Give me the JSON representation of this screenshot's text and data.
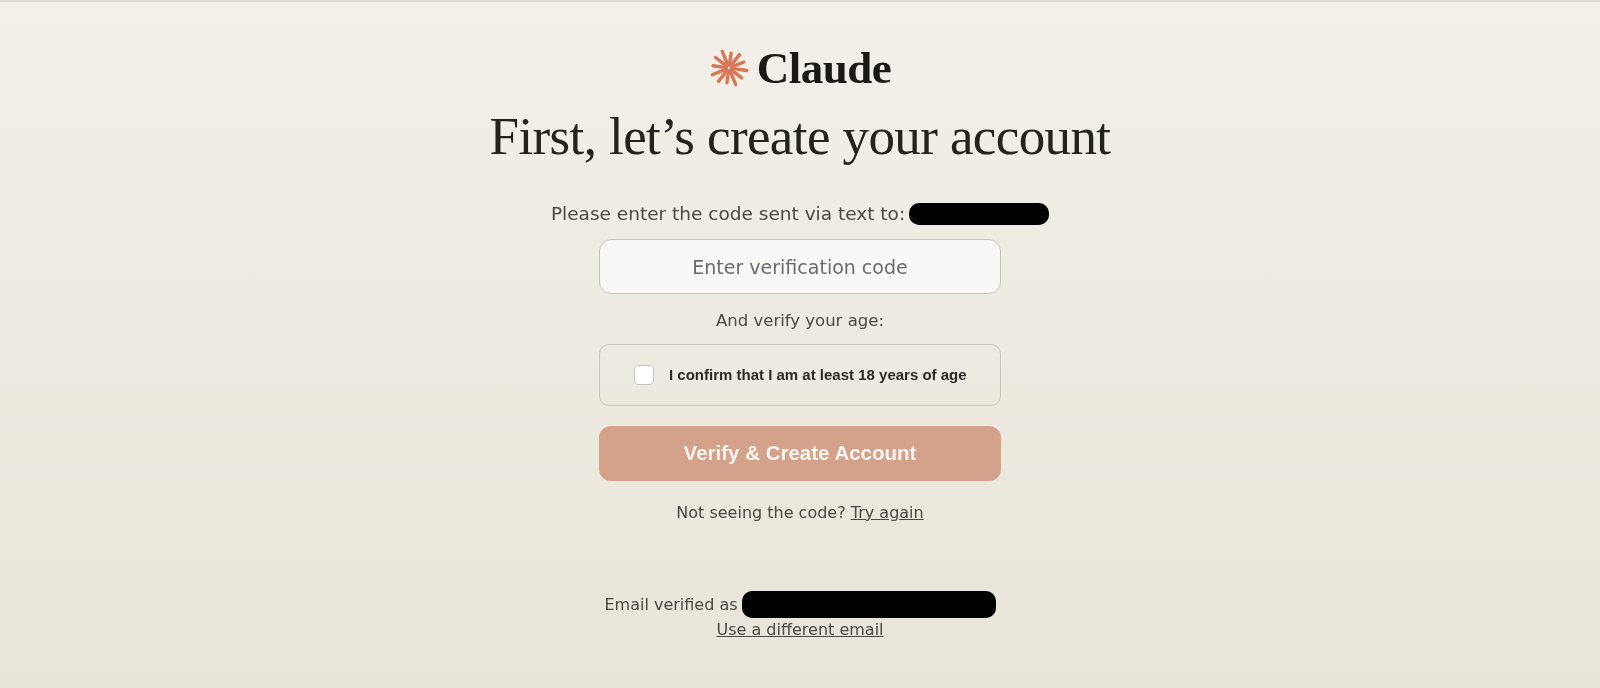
{
  "logo": {
    "wordmark": "Claude"
  },
  "heading": "First, let’s create your account",
  "phone_prompt": {
    "text": "Please enter the code sent via text to:",
    "redacted": true
  },
  "code_field": {
    "placeholder": "Enter verification code"
  },
  "age_prompt": "And verify your age:",
  "age_checkbox": {
    "label": "I confirm that I am at least 18 years of age",
    "checked": false
  },
  "submit_button": {
    "label": "Verify & Create Account",
    "disabled": true
  },
  "resend": {
    "text": "Not seeing the code?",
    "link": "Try again"
  },
  "email": {
    "text": "Email verified as",
    "redacted": true,
    "link": "Use a different email"
  }
}
